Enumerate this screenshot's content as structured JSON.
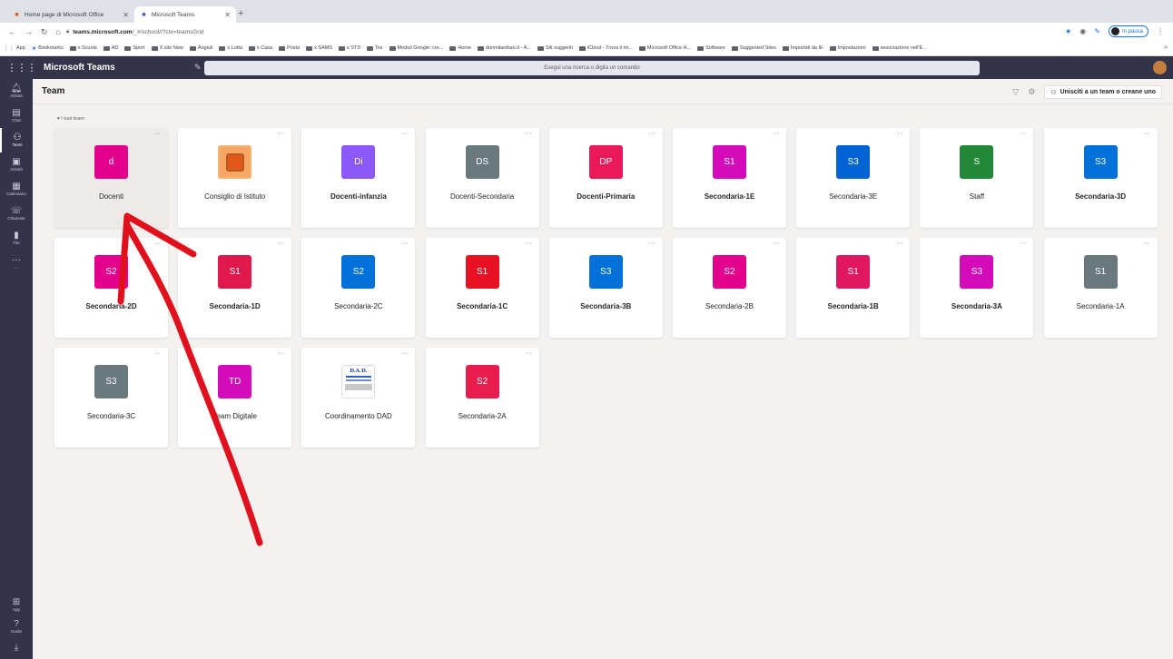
{
  "browser": {
    "tabs": [
      {
        "title": "Home page di Microsoft Office",
        "icon": "office-icon"
      },
      {
        "title": "Microsoft Teams",
        "icon": "teams-icon"
      }
    ],
    "url_domain": "teams.microsoft.com",
    "url_path": "/_#/school//?ctx=teamsGrid",
    "profile_label": "In pausa",
    "bookmarks": [
      "App",
      "Bookmarks",
      "x Scuola",
      "AD",
      "Sport",
      "X sito New",
      "Angiuli",
      "x Lotta",
      "x Casa",
      "Posta",
      "x SAMS",
      "x STS",
      "Tes",
      "Moduli Google: cre...",
      "Home",
      "donmilaniban.it - A...",
      "Siti suggeriti",
      "iCloud - Trova il mi...",
      "Microsoft Office H...",
      "Software",
      "Suggested Sites",
      "Importati da IE",
      "Impostazioni",
      "associazione nell'E..."
    ]
  },
  "teams": {
    "app_name": "Microsoft Teams",
    "search_placeholder": "Esegui una ricerca o digita un comando",
    "rail": [
      {
        "label": "Attività",
        "icon": "bell-icon"
      },
      {
        "label": "Chat",
        "icon": "chat-icon"
      },
      {
        "label": "Team",
        "icon": "teams-icon"
      },
      {
        "label": "Attività",
        "icon": "assignments-icon"
      },
      {
        "label": "Calendario",
        "icon": "calendar-icon"
      },
      {
        "label": "Chiamate",
        "icon": "phone-icon"
      },
      {
        "label": "File",
        "icon": "file-icon"
      },
      {
        "label": "...",
        "icon": "more-icon"
      }
    ],
    "rail_bottom": [
      {
        "label": "App",
        "icon": "apps-icon"
      },
      {
        "label": "Guida",
        "icon": "help-icon"
      },
      {
        "label": "",
        "icon": "download-icon"
      }
    ],
    "page_title": "Team",
    "join_button": "Unisciti a un team o creane uno",
    "section_label": "I tuoi team",
    "cards": [
      {
        "abbr": "d",
        "name": "Docenti",
        "color": "#e3008c",
        "bold": false,
        "selected": true
      },
      {
        "abbr": "",
        "name": "Consiglio di Istituto",
        "color": "#f8a763",
        "bold": false,
        "kind": "office"
      },
      {
        "abbr": "Di",
        "name": "Docenti-infanzia",
        "color": "#8c58f7",
        "bold": true
      },
      {
        "abbr": "DS",
        "name": "Docenti-Secondaria",
        "color": "#69797e",
        "bold": false
      },
      {
        "abbr": "DP",
        "name": "Docenti-Primaria",
        "color": "#ea1a5a",
        "bold": true
      },
      {
        "abbr": "S1",
        "name": "Secondaria-1E",
        "color": "#d40bb8",
        "bold": true
      },
      {
        "abbr": "S3",
        "name": "Secondaria-3E",
        "color": "#0063d4",
        "bold": false
      },
      {
        "abbr": "S",
        "name": "Staff",
        "color": "#23873a",
        "bold": false
      },
      {
        "abbr": "S3",
        "name": "Secondaria-3D",
        "color": "#0071d9",
        "bold": true
      },
      {
        "abbr": "S2",
        "name": "Secondaria-2D",
        "color": "#e3008c",
        "bold": true
      },
      {
        "abbr": "S1",
        "name": "Secondaria-1D",
        "color": "#e0184d",
        "bold": true
      },
      {
        "abbr": "S2",
        "name": "Secondaria-2C",
        "color": "#0071d9",
        "bold": false
      },
      {
        "abbr": "S1",
        "name": "Secondaria-1C",
        "color": "#e81123",
        "bold": true
      },
      {
        "abbr": "S3",
        "name": "Secondaria-3B",
        "color": "#0071d9",
        "bold": true
      },
      {
        "abbr": "S2",
        "name": "Secondaria-2B",
        "color": "#e3008c",
        "bold": false
      },
      {
        "abbr": "S1",
        "name": "Secondaria-1B",
        "color": "#e0185f",
        "bold": true
      },
      {
        "abbr": "S3",
        "name": "Secondaria-3A",
        "color": "#d40bb8",
        "bold": true
      },
      {
        "abbr": "S1",
        "name": "Secondaria-1A",
        "color": "#69797e",
        "bold": false
      },
      {
        "abbr": "S3",
        "name": "Secondaria-3C",
        "color": "#69797e",
        "bold": false
      },
      {
        "abbr": "TD",
        "name": "Team Digitale",
        "color": "#d40bb8",
        "bold": false
      },
      {
        "abbr": "D.A.D.",
        "name": "Coordinamento DAD",
        "color": "#ffffff",
        "bold": false,
        "kind": "dad"
      },
      {
        "abbr": "S2",
        "name": "Secondaria-2A",
        "color": "#e81c4e",
        "bold": false
      }
    ]
  },
  "colors": {
    "teams_bar": "#33344a",
    "annotation_arrow": "#e0101c"
  }
}
